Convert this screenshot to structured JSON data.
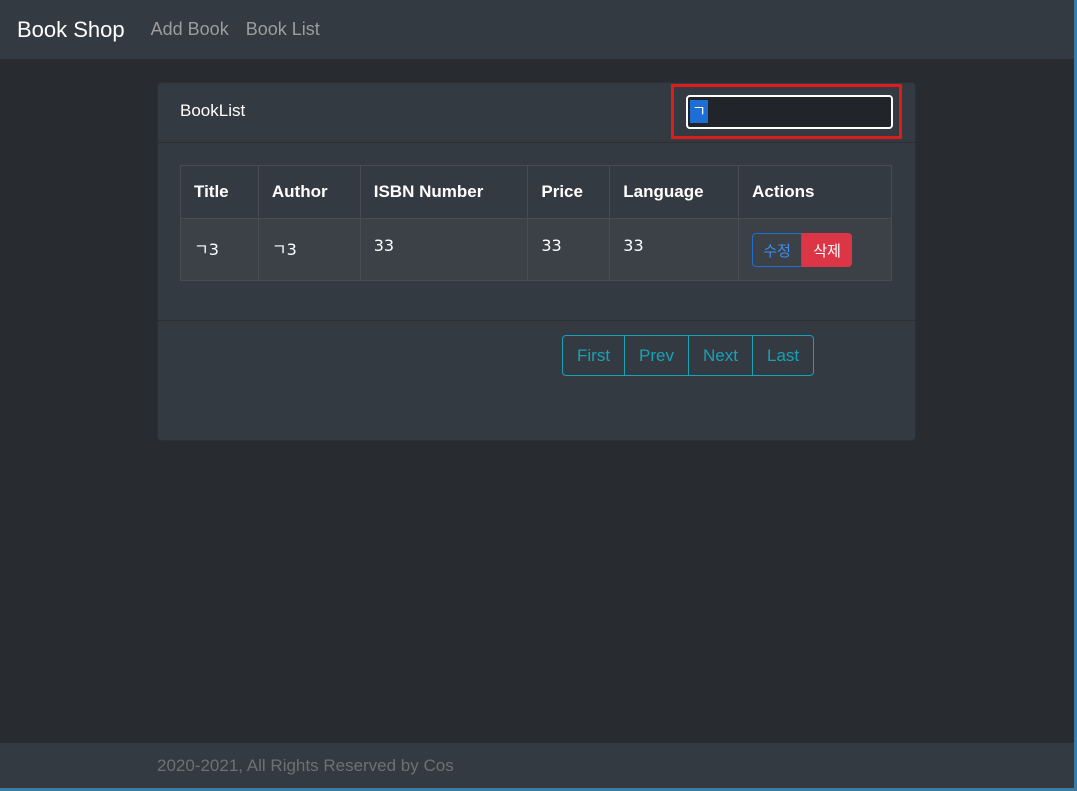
{
  "navbar": {
    "brand": "Book Shop",
    "links": [
      "Add Book",
      "Book List"
    ]
  },
  "card": {
    "title": "BookList",
    "search": {
      "value": "ㄱ",
      "composing_char": "ㄱ"
    }
  },
  "table": {
    "headers": [
      "Title",
      "Author",
      "ISBN Number",
      "Price",
      "Language",
      "Actions"
    ],
    "rows": [
      {
        "title": "ㄱ3",
        "author": "ㄱ3",
        "isbn": "33",
        "price": "33",
        "language": "33",
        "edit_label": "수정",
        "delete_label": "삭제"
      }
    ]
  },
  "pagination": {
    "first": "First",
    "prev": "Prev",
    "next": "Next",
    "last": "Last"
  },
  "footer": {
    "text": "2020-2021, All Rights Reserved by Cos"
  },
  "colors": {
    "background": "#282b30",
    "navbar": "#343a41",
    "highlight": "#e01b1b",
    "info": "#17a2b8",
    "primary": "#1f6fd1",
    "danger": "#dc3545"
  }
}
